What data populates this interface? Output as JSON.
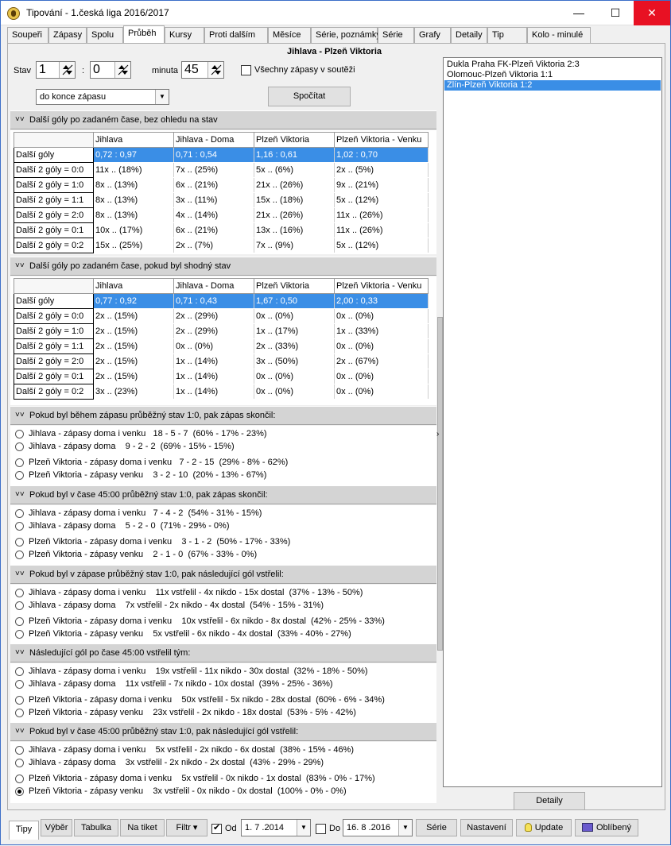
{
  "window": {
    "title": "Tipování - 1.česká liga 2016/2017"
  },
  "tabs": [
    {
      "label": "Soupeři"
    },
    {
      "label": "Zápasy"
    },
    {
      "label": "Spolu"
    },
    {
      "label": "Průběh"
    },
    {
      "label": "Kursy"
    },
    {
      "label": "Proti dalším"
    },
    {
      "label": "Měsíce"
    },
    {
      "label": "Série, poznámky"
    },
    {
      "label": "Série"
    },
    {
      "label": "Grafy"
    },
    {
      "label": "Detaily"
    },
    {
      "label": "Tip"
    },
    {
      "label": "Kolo - minulé"
    }
  ],
  "header": {
    "match_title": "Jihlava - Plzeň Viktoria"
  },
  "controls": {
    "stav_label": "Stav",
    "score_home": "1",
    "colon": ":",
    "score_away": "0",
    "minute_label": "minuta",
    "minute": "45",
    "all_matches_label": "Všechny zápasy v soutěži",
    "range_select": "do konce zápasu",
    "calc_button": "Spočítat"
  },
  "section1": {
    "title": "Další góly po zadaném čase, bez ohledu na stav",
    "columns": [
      "Jihlava",
      "Jihlava - Doma",
      "Plzeň Viktoria",
      "Plzeň Viktoria - Venku"
    ],
    "rows": [
      {
        "label": "Další góly",
        "cells": [
          "0,72 : 0,97",
          "0,71 : 0,54",
          "1,16 : 0,61",
          "1,02 : 0,70"
        ]
      },
      {
        "label": "Další 2 góly = 0:0",
        "cells": [
          "11x .. (18%)",
          "7x .. (25%)",
          "5x .. (6%)",
          "2x .. (5%)"
        ]
      },
      {
        "label": "Další 2 góly = 1:0",
        "cells": [
          "8x .. (13%)",
          "6x .. (21%)",
          "21x .. (26%)",
          "9x .. (21%)"
        ]
      },
      {
        "label": "Další 2 góly = 1:1",
        "cells": [
          "8x .. (13%)",
          "3x .. (11%)",
          "15x .. (18%)",
          "5x .. (12%)"
        ]
      },
      {
        "label": "Další 2 góly = 2:0",
        "cells": [
          "8x .. (13%)",
          "4x .. (14%)",
          "21x .. (26%)",
          "11x .. (26%)"
        ]
      },
      {
        "label": "Další 2 góly = 0:1",
        "cells": [
          "10x .. (17%)",
          "6x .. (21%)",
          "13x .. (16%)",
          "11x .. (26%)"
        ]
      },
      {
        "label": "Další 2 góly = 0:2",
        "cells": [
          "15x .. (25%)",
          "2x .. (7%)",
          "7x .. (9%)",
          "5x .. (12%)"
        ]
      }
    ]
  },
  "section2": {
    "title": "Další góly po zadaném čase, pokud byl shodný stav",
    "columns": [
      "Jihlava",
      "Jihlava - Doma",
      "Plzeň Viktoria",
      "Plzeň Viktoria - Venku"
    ],
    "rows": [
      {
        "label": "Další góly",
        "cells": [
          "0,77 : 0,92",
          "0,71 : 0,43",
          "1,67 : 0,50",
          "2,00 : 0,33"
        ]
      },
      {
        "label": "Další 2 góly = 0:0",
        "cells": [
          "2x .. (15%)",
          "2x .. (29%)",
          "0x .. (0%)",
          "0x .. (0%)"
        ]
      },
      {
        "label": "Další 2 góly = 1:0",
        "cells": [
          "2x .. (15%)",
          "2x .. (29%)",
          "1x .. (17%)",
          "1x .. (33%)"
        ]
      },
      {
        "label": "Další 2 góly = 1:1",
        "cells": [
          "2x .. (15%)",
          "0x .. (0%)",
          "2x .. (33%)",
          "0x .. (0%)"
        ]
      },
      {
        "label": "Další 2 góly = 2:0",
        "cells": [
          "2x .. (15%)",
          "1x .. (14%)",
          "3x .. (50%)",
          "2x .. (67%)"
        ]
      },
      {
        "label": "Další 2 góly = 0:1",
        "cells": [
          "2x .. (15%)",
          "1x .. (14%)",
          "0x .. (0%)",
          "0x .. (0%)"
        ]
      },
      {
        "label": "Další 2 góly = 0:2",
        "cells": [
          "3x .. (23%)",
          "1x .. (14%)",
          "0x .. (0%)",
          "0x .. (0%)"
        ]
      }
    ]
  },
  "radio_sections": [
    {
      "title": "Pokud byl během zápasu průběžný stav 1:0, pak zápas skončil:",
      "items": [
        {
          "label": "Jihlava - zápasy doma i venku   18 - 5 - 7  (60% - 17% - 23%)",
          "checked": false
        },
        {
          "label": "Jihlava - zápasy doma    9 - 2 - 2  (69% - 15% - 15%)",
          "checked": false
        },
        {
          "label": "Plzeň Viktoria - zápasy doma i venku   7 - 2 - 15  (29% - 8% - 62%)",
          "checked": false
        },
        {
          "label": "Plzeň Viktoria - zápasy venku    3 - 2 - 10  (20% - 13% - 67%)",
          "checked": false
        }
      ]
    },
    {
      "title": "Pokud byl v čase 45:00 průběžný stav 1:0, pak zápas skončil:",
      "items": [
        {
          "label": "Jihlava - zápasy doma i venku   7 - 4 - 2  (54% - 31% - 15%)",
          "checked": false
        },
        {
          "label": "Jihlava - zápasy doma    5 - 2 - 0  (71% - 29% - 0%)",
          "checked": false
        },
        {
          "label": "Plzeň Viktoria - zápasy doma i venku    3 - 1 - 2  (50% - 17% - 33%)",
          "checked": false
        },
        {
          "label": "Plzeň Viktoria - zápasy venku    2 - 1 - 0  (67% - 33% - 0%)",
          "checked": false
        }
      ]
    },
    {
      "title": "Pokud byl v zápase průběžný stav 1:0, pak následující gól vstřelil:",
      "items": [
        {
          "label": "Jihlava - zápasy doma i venku    11x vstřelil - 4x nikdo - 15x dostal  (37% - 13% - 50%)",
          "checked": false
        },
        {
          "label": "Jihlava - zápasy doma    7x vstřelil - 2x nikdo - 4x dostal  (54% - 15% - 31%)",
          "checked": false
        },
        {
          "label": "Plzeň Viktoria - zápasy doma i venku    10x vstřelil - 6x nikdo - 8x dostal  (42% - 25% - 33%)",
          "checked": false
        },
        {
          "label": "Plzeň Viktoria - zápasy venku    5x vstřelil - 6x nikdo - 4x dostal  (33% - 40% - 27%)",
          "checked": false
        }
      ]
    },
    {
      "title": "Následující gól po čase 45:00 vstřelil tým:",
      "items": [
        {
          "label": "Jihlava - zápasy doma i venku    19x vstřelil - 11x nikdo - 30x dostal  (32% - 18% - 50%)",
          "checked": false
        },
        {
          "label": "Jihlava - zápasy doma    11x vstřelil - 7x nikdo - 10x dostal  (39% - 25% - 36%)",
          "checked": false
        },
        {
          "label": "Plzeň Viktoria - zápasy doma i venku    50x vstřelil - 5x nikdo - 28x dostal  (60% - 6% - 34%)",
          "checked": false
        },
        {
          "label": "Plzeň Viktoria - zápasy venku    23x vstřelil - 2x nikdo - 18x dostal  (53% - 5% - 42%)",
          "checked": false
        }
      ]
    },
    {
      "title": "Pokud byl v čase 45:00 průběžný stav 1:0, pak následující gól vstřelil:",
      "items": [
        {
          "label": "Jihlava - zápasy doma i venku    5x vstřelil - 2x nikdo - 6x dostal  (38% - 15% - 46%)",
          "checked": false
        },
        {
          "label": "Jihlava - zápasy doma    3x vstřelil - 2x nikdo - 2x dostal  (43% - 29% - 29%)",
          "checked": false
        },
        {
          "label": "Plzeň Viktoria - zápasy doma i venku    5x vstřelil - 0x nikdo - 1x dostal  (83% - 0% - 17%)",
          "checked": false
        },
        {
          "label": "Plzeň Viktoria - zápasy venku    3x vstřelil - 0x nikdo - 0x dostal  (100% - 0% - 0%)",
          "checked": true
        }
      ]
    }
  ],
  "match_list": [
    {
      "label": "Dukla Praha FK-Plzeň Viktoria 2:3",
      "selected": false
    },
    {
      "label": "Olomouc-Plzeň Viktoria 1:1",
      "selected": false
    },
    {
      "label": "Zlín-Plzeň Viktoria 1:2",
      "selected": true
    }
  ],
  "detail_button": "Detaily",
  "bottom": {
    "tipy": "Tipy",
    "vyber": "Výběr",
    "tabulka": "Tabulka",
    "na_tiket": "Na tiket",
    "filtr": "Filtr",
    "od_label": "Od",
    "od_checked": true,
    "od_date": "1. 7 .2014",
    "do_label": "Do",
    "do_checked": false,
    "do_date": "16. 8 .2016",
    "serie": "Série",
    "nastaveni": "Nastavení",
    "update": "Update",
    "oblibeny": "Oblíbený"
  }
}
